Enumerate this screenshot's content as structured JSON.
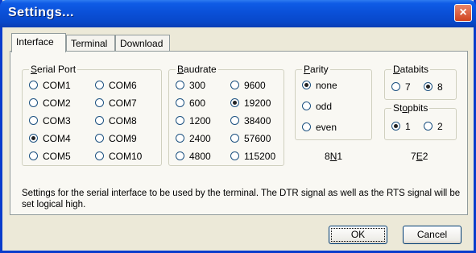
{
  "window": {
    "title": "Settings...",
    "close_glyph": "×"
  },
  "tabs": [
    {
      "label": "Interface",
      "active": true
    },
    {
      "label": "Terminal",
      "active": false
    },
    {
      "label": "Download",
      "active": false
    }
  ],
  "serial_port": {
    "title_prefix": "",
    "title_u": "S",
    "title_rest": "erial Port",
    "options": [
      "COM1",
      "COM2",
      "COM3",
      "COM4",
      "COM5",
      "COM6",
      "COM7",
      "COM8",
      "COM9",
      "COM10"
    ],
    "selected": "COM4"
  },
  "baudrate": {
    "title_u": "B",
    "title_rest": "audrate",
    "options": [
      "300",
      "600",
      "1200",
      "2400",
      "4800",
      "9600",
      "19200",
      "38400",
      "57600",
      "115200"
    ],
    "selected": "19200"
  },
  "parity": {
    "title_u": "P",
    "title_rest": "arity",
    "options": [
      "none",
      "odd",
      "even"
    ],
    "selected": "none"
  },
  "databits": {
    "title_u": "D",
    "title_rest": "atabits",
    "options": [
      "7",
      "8"
    ],
    "selected": "8"
  },
  "stopbits": {
    "title_prefix": "St",
    "title_u": "o",
    "title_rest": "pbits",
    "options": [
      "1",
      "2"
    ],
    "selected": "1"
  },
  "quick": {
    "a_prefix": "8",
    "a_u": "N",
    "a_rest": "1",
    "b_prefix": "7",
    "b_u": "E",
    "b_rest": "2"
  },
  "description": "Settings for the serial interface to be used by the terminal. The DTR signal as well as the RTS signal will be set logical high.",
  "buttons": {
    "ok": "OK",
    "cancel": "Cancel"
  },
  "colors": {
    "title_bar": "#0A50D8",
    "dialog_bg": "#ECE9D8",
    "radio_dot": "#21A121"
  }
}
